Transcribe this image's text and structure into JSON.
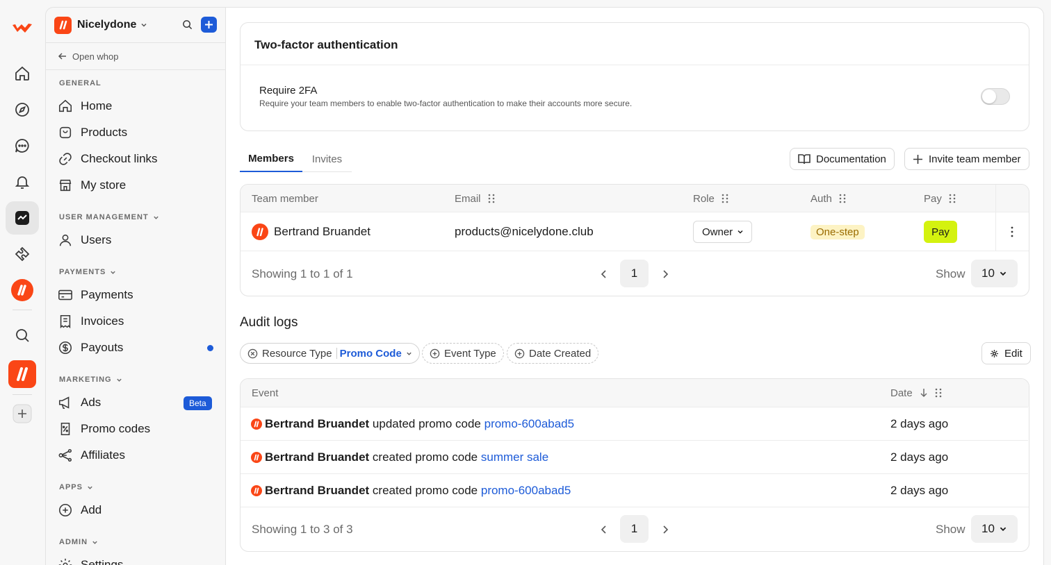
{
  "brand": {
    "name": "Nicelydone",
    "open_whop": "Open whop",
    "accent": "#fa4616"
  },
  "sidebar": {
    "sections": [
      {
        "title": "GENERAL"
      },
      {
        "title": "USER MANAGEMENT"
      },
      {
        "title": "PAYMENTS"
      },
      {
        "title": "MARKETING"
      },
      {
        "title": "APPS"
      },
      {
        "title": "ADMIN"
      }
    ],
    "items": {
      "home": "Home",
      "products": "Products",
      "checkout_links": "Checkout links",
      "my_store": "My store",
      "users": "Users",
      "payments": "Payments",
      "invoices": "Invoices",
      "payouts": "Payouts",
      "ads": "Ads",
      "ads_badge": "Beta",
      "promo_codes": "Promo codes",
      "affiliates": "Affiliates",
      "add": "Add",
      "settings": "Settings"
    }
  },
  "twofa": {
    "title": "Two-factor authentication",
    "setting_label": "Require 2FA",
    "setting_desc": "Require your team members to enable two-factor authentication to make their accounts more secure.",
    "enabled": false
  },
  "tabs": {
    "members": "Members",
    "invites": "Invites"
  },
  "actions": {
    "documentation": "Documentation",
    "invite": "Invite team member"
  },
  "members_table": {
    "headers": {
      "member": "Team member",
      "email": "Email",
      "role": "Role",
      "auth": "Auth",
      "pay": "Pay"
    },
    "row": {
      "name": "Bertrand Bruandet",
      "email": "products@nicelydone.club",
      "role": "Owner",
      "auth": "One-step",
      "pay": "Pay"
    },
    "footer": {
      "showing": "Showing 1 to 1 of 1",
      "page": "1",
      "show_label": "Show",
      "page_size": "10"
    }
  },
  "audit": {
    "title": "Audit logs",
    "filters": {
      "resource_type": "Resource Type",
      "resource_value": "Promo Code",
      "event_type": "Event Type",
      "date_created": "Date Created"
    },
    "edit": "Edit",
    "headers": {
      "event": "Event",
      "date": "Date"
    },
    "rows": [
      {
        "actor": "Bertrand Bruandet",
        "action": "updated promo code",
        "target": "promo-600abad5",
        "date": "2 days ago"
      },
      {
        "actor": "Bertrand Bruandet",
        "action": "created promo code",
        "target": "summer sale",
        "date": "2 days ago"
      },
      {
        "actor": "Bertrand Bruandet",
        "action": "created promo code",
        "target": "promo-600abad5",
        "date": "2 days ago"
      }
    ],
    "footer": {
      "showing": "Showing 1 to 3 of 3",
      "page": "1",
      "show_label": "Show",
      "page_size": "10"
    }
  },
  "colors": {
    "link": "#1d5bd8",
    "beta": "#1d5bd8",
    "one_step_bg": "#fdf3c4",
    "pay_bg": "#d4f20f"
  }
}
